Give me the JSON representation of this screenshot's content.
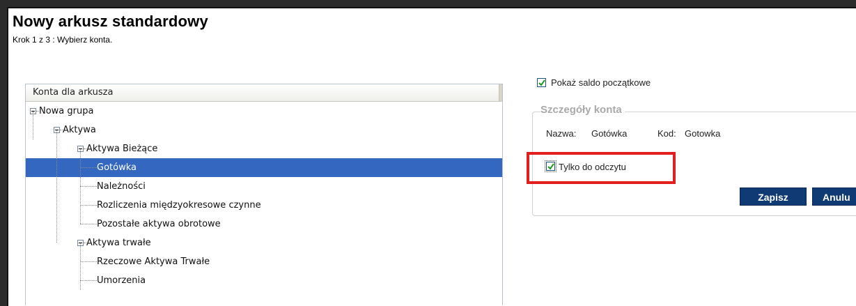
{
  "page": {
    "title": "Nowy arkusz standardowy",
    "step": "Krok 1 z 3 : Wybierz konta."
  },
  "tree": {
    "header": "Konta dla arkusza",
    "nodes": [
      {
        "label": "Nowa grupa",
        "level": 0,
        "expandable": true,
        "selected": false
      },
      {
        "label": "Aktywa",
        "level": 1,
        "expandable": true,
        "selected": false
      },
      {
        "label": "Aktywa Bieżące",
        "level": 2,
        "expandable": true,
        "selected": false
      },
      {
        "label": "Gotówka",
        "level": 3,
        "expandable": false,
        "selected": true
      },
      {
        "label": "Należności",
        "level": 3,
        "expandable": false,
        "selected": false
      },
      {
        "label": "Rozliczenia międzyokresowe czynne",
        "level": 3,
        "expandable": false,
        "selected": false
      },
      {
        "label": "Pozostałe aktywa obrotowe",
        "level": 3,
        "expandable": false,
        "selected": false
      },
      {
        "label": "Aktywa trwałe",
        "level": 2,
        "expandable": true,
        "selected": false
      },
      {
        "label": "Rzeczowe Aktywa Trwałe",
        "level": 3,
        "expandable": false,
        "selected": false
      },
      {
        "label": "Umorzenia",
        "level": 3,
        "expandable": false,
        "selected": false
      }
    ]
  },
  "options": {
    "show_opening_balance": {
      "label": "Pokaż saldo początkowe",
      "checked": true
    }
  },
  "details": {
    "legend": "Szczegóły konta",
    "name_label": "Nazwa:",
    "name_value": "Gotówka",
    "code_label": "Kod:",
    "code_value": "Gotowka",
    "readonly": {
      "label": "Tylko do odczytu",
      "checked": true
    },
    "save_label": "Zapisz",
    "cancel_label": "Anulu"
  },
  "colors": {
    "selection": "#3468c0",
    "button": "#0f3a73",
    "highlight": "#e31e1e"
  }
}
